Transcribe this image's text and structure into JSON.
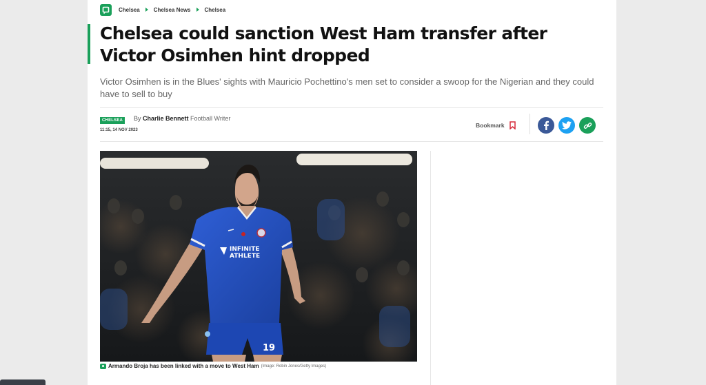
{
  "breadcrumbs": [
    "Chelsea",
    "Chelsea News",
    "Chelsea"
  ],
  "article": {
    "headline": "Chelsea could sanction West Ham transfer after Victor Osimhen hint dropped",
    "standfirst": "Victor Osimhen is in the Blues' sights with Mauricio Pochettino's men set to consider a swoop for the Nigerian and they could have to sell to buy",
    "tag": "CHELSEA",
    "by_prefix": "By ",
    "author": "Charlie Bennett",
    "author_role": " Football Writer",
    "timestamp": "11:15, 14 NOV 2023",
    "bookmark_label": "Bookmark",
    "share_icons": [
      "facebook-icon",
      "twitter-icon",
      "link-icon"
    ],
    "image": {
      "kit_text_1": "INFINITE",
      "kit_text_2": "ATHLETE",
      "shirt_number": "19",
      "caption": "Armando Broja has been linked with a move to West Ham",
      "credit": "(Image: Robin Jones/Getty Images)"
    }
  },
  "colors": {
    "accent": "#1aa05a",
    "facebook": "#3b5998",
    "twitter": "#1da1f2",
    "kit": "#1f4fc4"
  }
}
